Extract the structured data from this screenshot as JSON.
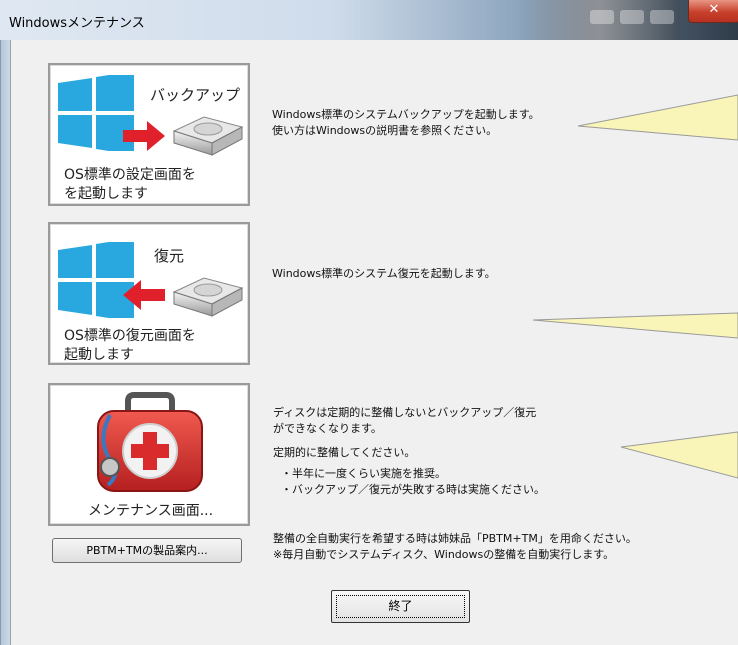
{
  "window": {
    "title": "Windowsメンテナンス",
    "close_glyph": "✕"
  },
  "backup_button": {
    "top_label": "バックアップ",
    "caption_lines": [
      "OS標準の設定画面を",
      "を起動します"
    ]
  },
  "restore_button": {
    "top_label": "復元",
    "caption_lines": [
      "OS標準の復元画面を",
      "起動します"
    ]
  },
  "maintenance_button": {
    "caption": "メンテナンス画面..."
  },
  "product_button": {
    "label": "PBTM+TMの製品案内..."
  },
  "descriptions": {
    "backup": [
      "Windows標準のシステムバックアップを起動します。",
      "使い方はWindowsの説明書を参照ください。"
    ],
    "restore": "Windows標準のシステム復元を起動します。",
    "maintenance": [
      "ディスクは定期的に整備しないとバックアップ／復元",
      "ができなくなります。"
    ],
    "maintenance_advice": "定期的に整備してください。",
    "maintenance_tips": [
      "・半年に一度くらい実施を推奨。",
      "・バックアップ／復元が失敗する時は実施ください。"
    ],
    "auto_run": [
      "整備の全自動実行を希望する時は姉妹品「PBTM+TM」を用命ください。",
      "※毎月自動でシステムディスク、Windowsの整備を自動実行します。"
    ]
  },
  "end_button": {
    "label": "終了"
  },
  "icons": {
    "windows_logo": "windows-logo-icon",
    "drive": "hard-drive-icon",
    "arrow": "red-arrow-icon",
    "first_aid": "first-aid-kit-icon"
  },
  "colors": {
    "windows_blue": "#29a8e0",
    "arrow_red": "#e0202a",
    "balloon_fill": "#f9f4b8",
    "kit_red": "#d92b2b"
  }
}
